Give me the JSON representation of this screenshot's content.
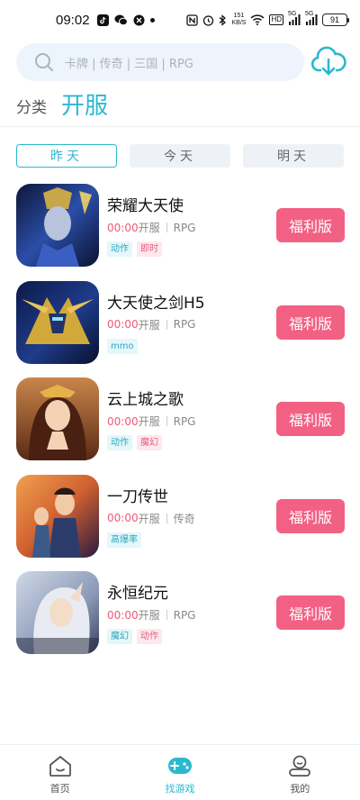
{
  "status_bar": {
    "time": "09:02",
    "net_speed_value": "151",
    "net_speed_unit": "KB/S",
    "hd": "HD",
    "signal1": "5G",
    "signal2": "5G",
    "battery": "91"
  },
  "search": {
    "placeholder": "卡牌 | 传奇 | 三国 | RPG"
  },
  "header": {
    "category_label": "分类",
    "page_title": "开服"
  },
  "day_tabs": [
    {
      "label": "昨天",
      "active": true
    },
    {
      "label": "今天",
      "active": false
    },
    {
      "label": "明天",
      "active": false
    }
  ],
  "games": [
    {
      "name": "荣耀大天使",
      "time": "00:00",
      "open_label": "开服",
      "genre": "RPG",
      "tags": [
        "动作",
        "即时"
      ],
      "button": "福利版"
    },
    {
      "name": "大天使之剑H5",
      "time": "00:00",
      "open_label": "开服",
      "genre": "RPG",
      "tags": [
        "mmo"
      ],
      "button": "福利版"
    },
    {
      "name": "云上城之歌",
      "time": "00:00",
      "open_label": "开服",
      "genre": "RPG",
      "tags": [
        "动作",
        "魔幻"
      ],
      "button": "福利版"
    },
    {
      "name": "一刀传世",
      "time": "00:00",
      "open_label": "开服",
      "genre": "传奇",
      "tags": [
        "高爆率"
      ],
      "button": "福利版"
    },
    {
      "name": "永恒纪元",
      "time": "00:00",
      "open_label": "开服",
      "genre": "RPG",
      "tags": [
        "魔幻",
        "动作"
      ],
      "button": "福利版"
    }
  ],
  "bottom_nav": [
    {
      "label": "首页",
      "icon": "home-icon",
      "active": false
    },
    {
      "label": "找游戏",
      "icon": "gamepad-icon",
      "active": true
    },
    {
      "label": "我的",
      "icon": "user-icon",
      "active": false
    }
  ],
  "colors": {
    "accent": "#2bb8cf",
    "button": "#f26083",
    "time_text": "#f0577b"
  }
}
